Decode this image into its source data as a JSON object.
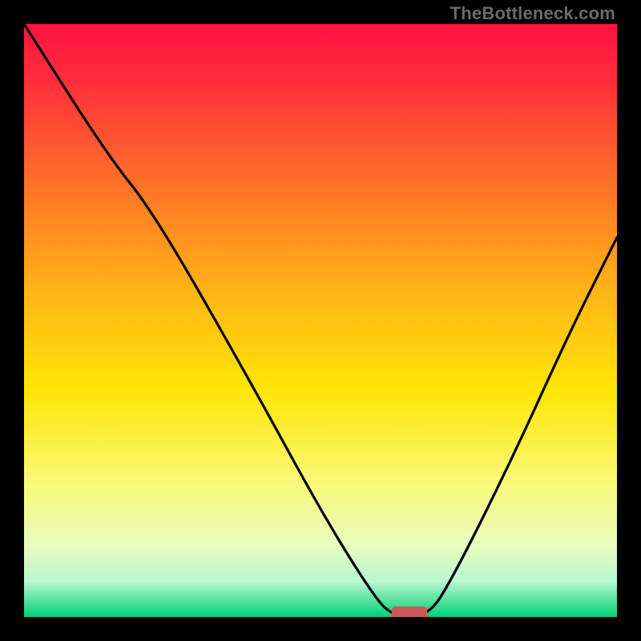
{
  "watermark": "TheBottleneck.com",
  "chart_data": {
    "type": "line",
    "title": "",
    "xlabel": "",
    "ylabel": "",
    "xlim": [
      0,
      100
    ],
    "ylim": [
      0,
      100
    ],
    "grid": false,
    "legend": false,
    "background_gradient_stops": [
      {
        "offset": 0.0,
        "color": "#ff1240"
      },
      {
        "offset": 0.1,
        "color": "#ff2f3a"
      },
      {
        "offset": 0.25,
        "color": "#ff6a2a"
      },
      {
        "offset": 0.45,
        "color": "#ffb417"
      },
      {
        "offset": 0.62,
        "color": "#ffe607"
      },
      {
        "offset": 0.78,
        "color": "#f9f97c"
      },
      {
        "offset": 0.88,
        "color": "#e8fbc0"
      },
      {
        "offset": 0.94,
        "color": "#b9f7d0"
      },
      {
        "offset": 0.975,
        "color": "#4ee09a"
      },
      {
        "offset": 1.0,
        "color": "#00d27a"
      }
    ],
    "curve_points": [
      {
        "x": 0,
        "y": 100
      },
      {
        "x": 14,
        "y": 78
      },
      {
        "x": 22,
        "y": 68
      },
      {
        "x": 38,
        "y": 40
      },
      {
        "x": 50,
        "y": 18
      },
      {
        "x": 58,
        "y": 5
      },
      {
        "x": 62,
        "y": 0
      },
      {
        "x": 68,
        "y": 0
      },
      {
        "x": 72,
        "y": 6
      },
      {
        "x": 82,
        "y": 26
      },
      {
        "x": 92,
        "y": 48
      },
      {
        "x": 100,
        "y": 64
      }
    ],
    "optimal_marker": {
      "x": 65,
      "y": 0,
      "width": 6,
      "height": 3,
      "color": "#c95a5a"
    }
  }
}
